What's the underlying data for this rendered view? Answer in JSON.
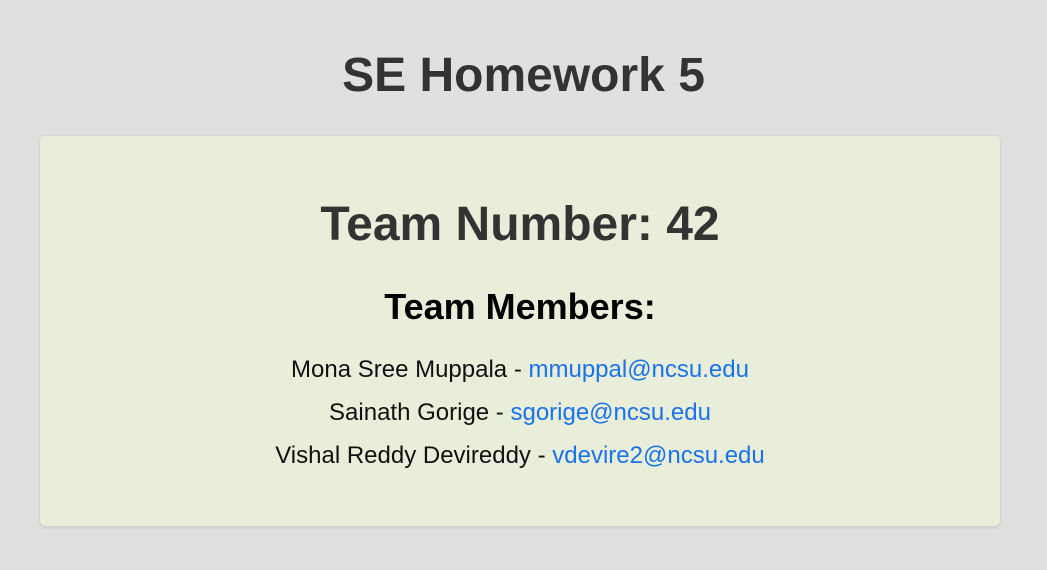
{
  "page": {
    "title": "SE Homework 5"
  },
  "card": {
    "team_number": "Team Number: 42",
    "members_heading": "Team Members:",
    "separator": " - ",
    "members": [
      {
        "name": "Mona Sree Muppala",
        "email": "mmuppal@ncsu.edu"
      },
      {
        "name": "Sainath Gorige",
        "email": "sgorige@ncsu.edu"
      },
      {
        "name": "Vishal Reddy Devireddy",
        "email": "vdevire2@ncsu.edu"
      }
    ]
  },
  "colors": {
    "background": "#e1e0df",
    "card": "#e8eed9",
    "heading": "#333333",
    "link": "#1a73e8"
  }
}
